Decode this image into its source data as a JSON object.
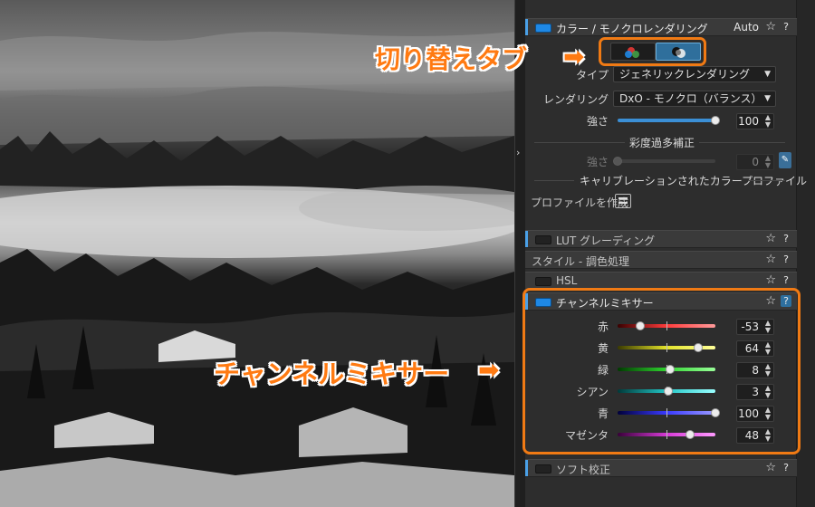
{
  "color_mono": {
    "title": "カラー / モノクロレンダリング",
    "auto_label": "Auto",
    "star": "☆",
    "help": "?",
    "type_label": "タイプ",
    "type_value": "ジェネリックレンダリング",
    "rendering_label": "レンダリング",
    "rendering_value": "DxO - モノクロ（バランス）",
    "strength_label": "強さ",
    "strength_value": "100",
    "strength_level": 100,
    "oversat_heading": "彩度過多補正",
    "oversat_strength_label": "強さ",
    "oversat_value": "0",
    "oversat_level": 0,
    "calibrated_heading": "キャリブレーションされたカラープロファイル",
    "create_profile_label": "プロファイルを作成"
  },
  "sections": {
    "lut": "LUT グレーディング",
    "style": "スタイル - 調色処理",
    "hsl": "HSL",
    "channel_mixer": "チャンネルミキサー",
    "soft_proof": "ソフト校正"
  },
  "channel_mixer": {
    "channels": [
      {
        "label": "赤",
        "value": "-53",
        "level": -53,
        "track": "linear-gradient(90deg,#3a0000,#ff3b3b,#ff9a9a)"
      },
      {
        "label": "黄",
        "value": "64",
        "level": 64,
        "track": "linear-gradient(90deg,#3a3a00,#e3e32a,#ffff9a)"
      },
      {
        "label": "緑",
        "value": "8",
        "level": 8,
        "track": "linear-gradient(90deg,#003a00,#2fd52f,#9aff9a)"
      },
      {
        "label": "シアン",
        "value": "3",
        "level": 3,
        "track": "linear-gradient(90deg,#003a3a,#22c6c6,#9affff)"
      },
      {
        "label": "青",
        "value": "100",
        "level": 100,
        "track": "linear-gradient(90deg,#00003a,#3a3aff,#9a9aff)"
      },
      {
        "label": "マゼンタ",
        "value": "48",
        "level": 48,
        "track": "linear-gradient(90deg,#3a003a,#d63ad6,#ff9aff)"
      }
    ]
  },
  "annotations": {
    "switch_tab": "切り替えタブ",
    "channel_mixer": "チャンネルミキサー",
    "arrow": "➡"
  },
  "icons": {
    "collapse": "›",
    "caret": "▼",
    "spin": "⌃⌄"
  },
  "colors": {
    "accent": "#4aa0e6",
    "toggle_on": "#1e88e5",
    "annotation": "#ff7a12"
  }
}
